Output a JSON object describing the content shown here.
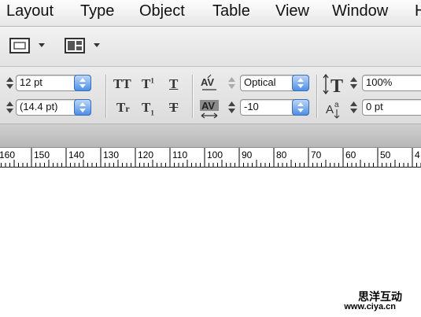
{
  "menu": [
    "Layout",
    "Type",
    "Object",
    "Table",
    "View",
    "Window",
    "H"
  ],
  "control": {
    "point_size": "12 pt",
    "leading": "(14.4 pt)",
    "kerning": "Optical",
    "tracking": "-10",
    "vertical_scale": "100%",
    "baseline_shift": "0 pt"
  },
  "ruler_labels": [
    "160",
    "150",
    "140",
    "130",
    "120",
    "110",
    "100",
    "90",
    "80",
    "70",
    "60",
    "50",
    "4"
  ],
  "watermark": {
    "title": "思洋互动",
    "url": "www.ciya.cn"
  }
}
